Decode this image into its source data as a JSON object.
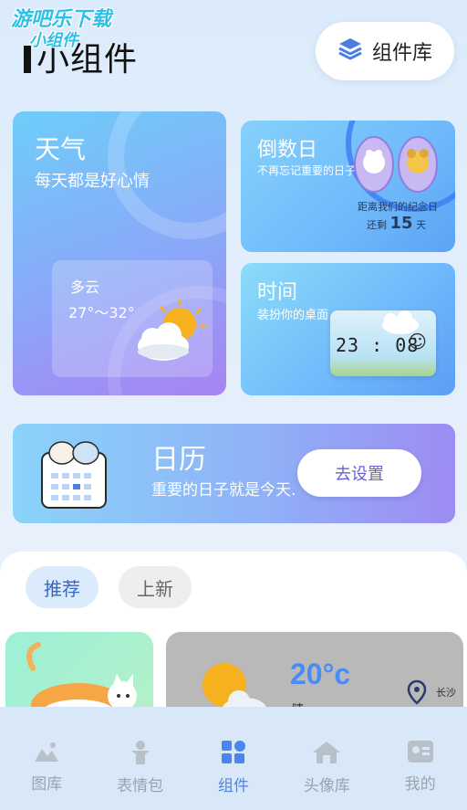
{
  "watermark": {
    "line1": "游吧乐下载",
    "line2": "小组件"
  },
  "header": {
    "title": "小组件",
    "library_button": "组件库",
    "library_icon": "layers-icon"
  },
  "weather_card": {
    "title": "天气",
    "subtitle": "每天都是好心情",
    "condition": "多云",
    "temperature": "27°～32°",
    "icon": "sun-cloud-icon"
  },
  "countdown_card": {
    "title": "倒数日",
    "subtitle": "不再忘记重要的日子",
    "line1": "距离我们的纪念日",
    "line2_prefix": "还剩",
    "days": "15",
    "line2_suffix": "天"
  },
  "time_card": {
    "title": "时间",
    "subtitle": "装扮你的桌面",
    "clock": "23 : 08",
    "face": "☺"
  },
  "calendar_card": {
    "title": "日历",
    "subtitle": "重要的日子就是今天.",
    "button": "去设置"
  },
  "tabs": {
    "recommend": "推荐",
    "new": "上新"
  },
  "weather_preview": {
    "temperature": "20°c",
    "condition": "晴",
    "city": "长沙"
  },
  "nav": {
    "items": [
      {
        "label": "图库",
        "icon": "gallery-icon",
        "active": false
      },
      {
        "label": "表情包",
        "icon": "figure-icon",
        "active": false
      },
      {
        "label": "组件",
        "icon": "widgets-icon",
        "active": true
      },
      {
        "label": "头像库",
        "icon": "house-icon",
        "active": false
      },
      {
        "label": "我的",
        "icon": "profile-card-icon",
        "active": false
      }
    ]
  },
  "colors": {
    "accent": "#4a86f0",
    "nav_inactive": "#9aa3ad",
    "button_text": "#6a5fd6"
  }
}
